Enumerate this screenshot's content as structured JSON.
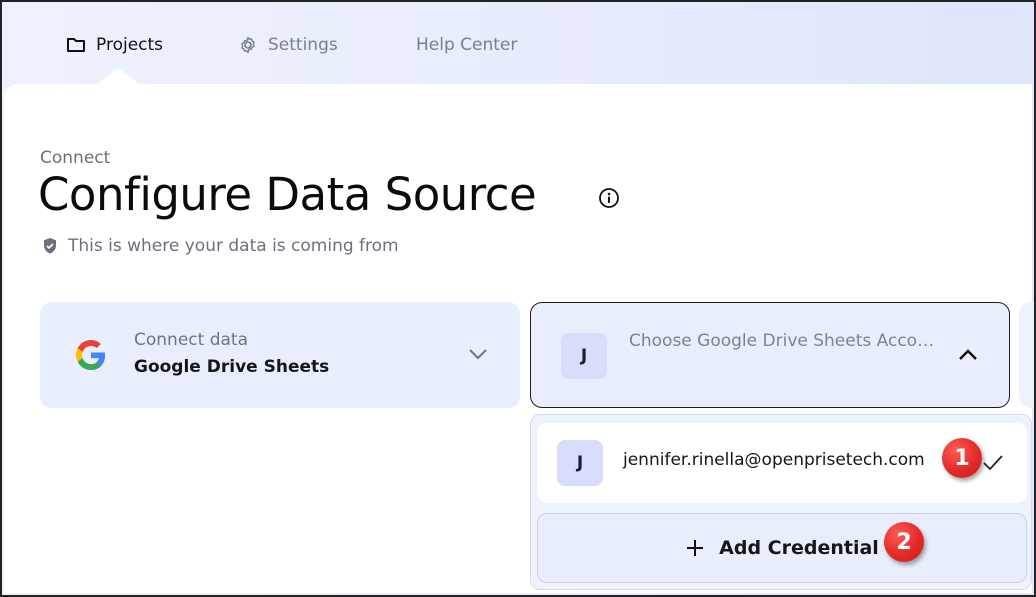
{
  "nav": {
    "items": [
      {
        "label": "Projects",
        "icon": "folder-icon",
        "active": true
      },
      {
        "label": "Settings",
        "icon": "gear-icon",
        "active": false
      },
      {
        "label": "Help Center",
        "icon": "",
        "active": false
      }
    ]
  },
  "header": {
    "breadcrumb": "Connect",
    "title": "Configure Data Source",
    "subtitle": "This is where your data is coming from"
  },
  "source_card": {
    "label": "Connect data",
    "value": "Google Drive Sheets",
    "icon": "google-logo-icon"
  },
  "account_card": {
    "avatar": "J",
    "placeholder": "Choose Google Drive Sheets Account"
  },
  "dropdown": {
    "options": [
      {
        "avatar": "J",
        "email": "jennifer.rinella@openprisetech.com",
        "selected": true
      }
    ],
    "add_label": "Add Credential"
  },
  "annotations": {
    "marker_1": "1",
    "marker_2": "2"
  },
  "colors": {
    "accent_bg": "#e9eefc",
    "avatar_bg": "#d9dcfb",
    "marker_red": "#e22a27"
  }
}
